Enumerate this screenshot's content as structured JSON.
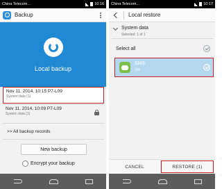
{
  "left": {
    "status": {
      "carrier": "China Telecom...",
      "time": "10:16"
    },
    "appbar": {
      "title": "Backup"
    },
    "hero": {
      "label": "Local backup"
    },
    "records": [
      {
        "title": "Nov 11, 2014, 10:15 P7-L09",
        "subtitle": "System data (1)",
        "locked": false
      },
      {
        "title": "Nov 11, 2014, 10:09 P7-L09",
        "subtitle": "System data (1)",
        "locked": true
      }
    ],
    "all_records_label": ">> All backup records",
    "new_backup_label": "New backup",
    "encrypt_label": "Encrypt your backup"
  },
  "right": {
    "status": {
      "carrier": "China Telecom...",
      "time": "10:17"
    },
    "appbar": {
      "title": "Local restore"
    },
    "group": {
      "title": "System data",
      "subtitle": "Selected: 1 of 1"
    },
    "select_all_label": "Select all",
    "items": [
      {
        "name": "SMS",
        "count": "186",
        "checked": true
      }
    ],
    "cancel_label": "CANCEL",
    "restore_label": "RESTORE (1)"
  }
}
